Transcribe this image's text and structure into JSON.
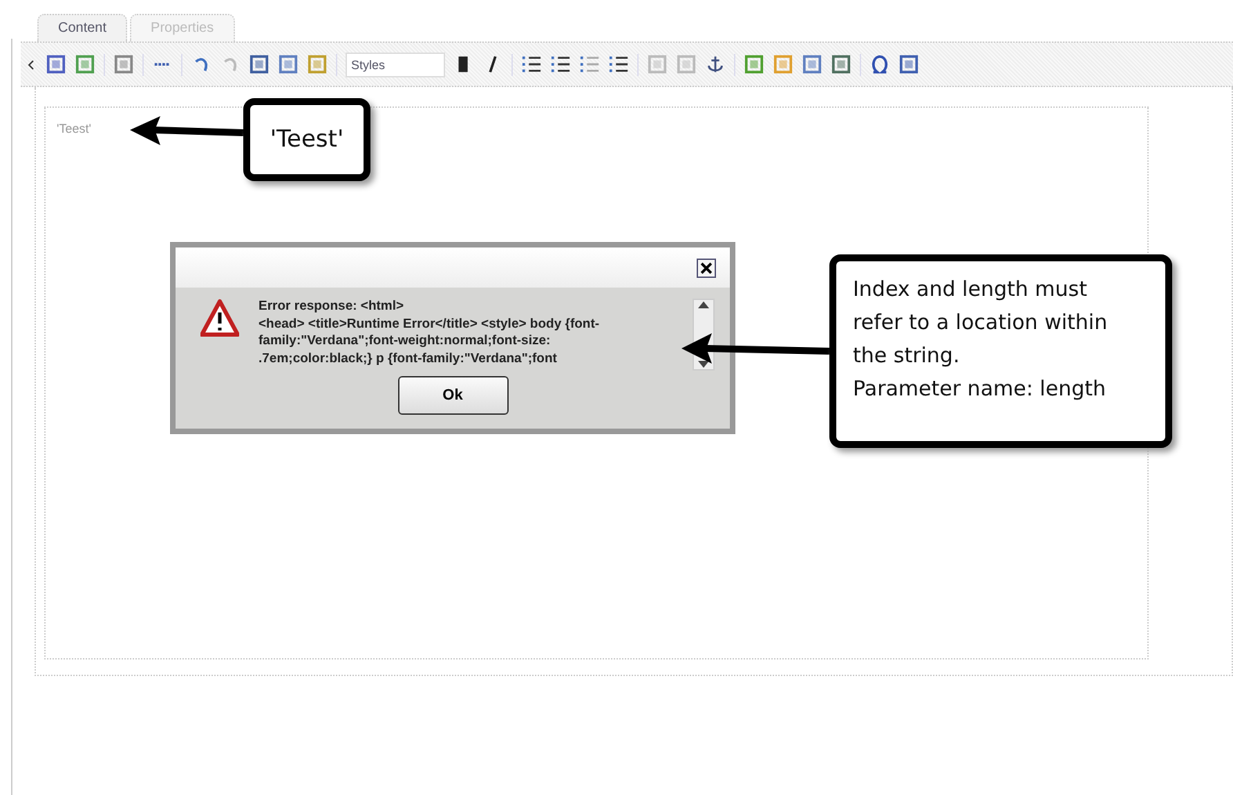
{
  "tabs": [
    {
      "label": "Content",
      "selected": true
    },
    {
      "label": "Properties",
      "selected": false
    }
  ],
  "toolbar": {
    "styles_dropdown": "Styles"
  },
  "editor": {
    "content": "'Teest'"
  },
  "dialog": {
    "message_lines": [
      "Error response: <html>",
      "<head> <title>Runtime Error</title> <style> body {font-",
      "family:\"Verdana\";font-weight:normal;font-size:",
      ".7em;color:black;} p {font-family:\"Verdana\";font"
    ],
    "ok_button": "Ok"
  },
  "callouts": [
    {
      "text": "'Teest'"
    },
    {
      "text": "Index and length must\nrefer to a location within\nthe string.\nParameter name: length"
    }
  ]
}
